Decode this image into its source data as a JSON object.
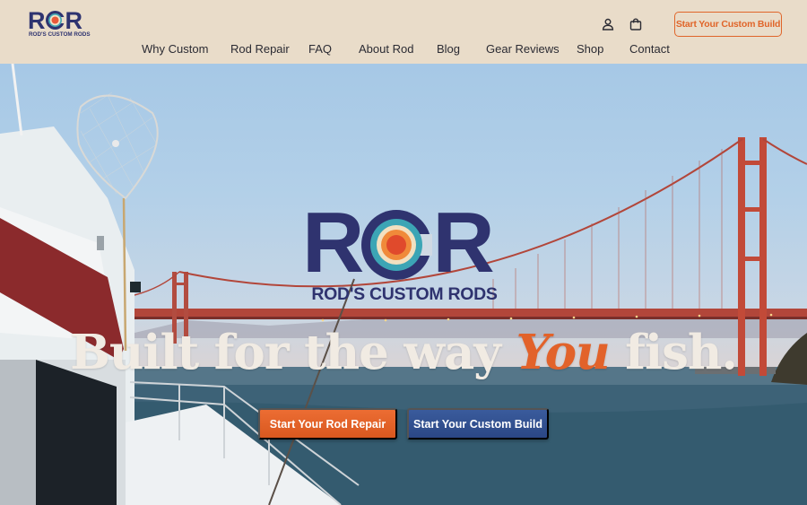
{
  "brand": {
    "logo_letters_left": "R",
    "logo_letters_right": "R",
    "logo_subtitle": "ROD'S CUSTOM RODS",
    "colors": {
      "navy": "#2f336f",
      "orange": "#e2622a",
      "cream": "#e9dcc9",
      "blue_button": "#2f4c8a"
    }
  },
  "header": {
    "icons": [
      "account-icon",
      "shopping-bag-icon"
    ],
    "cta_label": "Start Your Custom Build"
  },
  "nav": {
    "items": [
      "Why Custom",
      "Rod Repair",
      "FAQ",
      "About Rod",
      "Blog",
      "Gear Reviews",
      "Shop",
      "Contact"
    ]
  },
  "hero": {
    "logo_subtitle": "ROD'S CUSTOM RODS",
    "headline_before": "Built for the way ",
    "headline_emphasis": "You",
    "headline_after": " fish.",
    "primary_button": "Start Your Rod Repair",
    "secondary_button": "Start Your Custom Build"
  }
}
